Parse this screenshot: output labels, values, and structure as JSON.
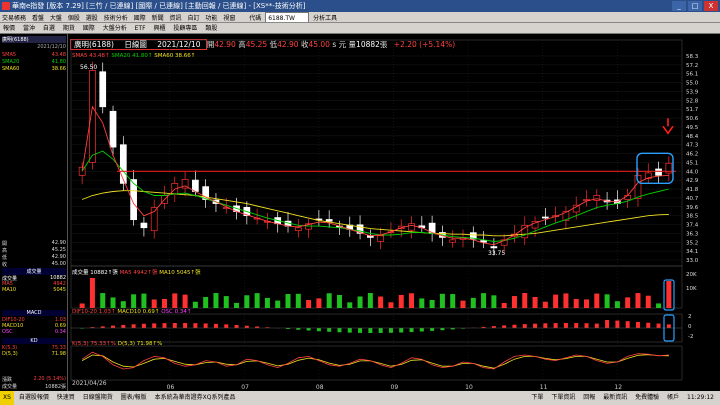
{
  "window": {
    "title": "華南e指發 [版本 7.29] [三竹 / 已連線] [國際 / 已連線] [主動回報 / 已連線] - [XS**-技術分析]",
    "controls": [
      "_",
      "□",
      "X"
    ]
  },
  "menubar": [
    "交易帳務",
    "看盤",
    "大盤",
    "個股",
    "選股",
    "技術分析",
    "國際",
    "新聞",
    "資訊",
    "自訂",
    "功能",
    "視窗"
  ],
  "toolbar": {
    "items": [
      "報價",
      "當沖",
      "自選",
      "期貨",
      "國際",
      "大盤分析",
      "ETF",
      "興櫃",
      "投顧專區",
      "類股"
    ],
    "code_label": "代碼",
    "code_value": "6188.TW",
    "analysis_tool": "分析工具"
  },
  "left_panel": {
    "tab": "廣明(6188)",
    "date_label": "2021/12/10",
    "legend_top": [
      {
        "name": "SMA5",
        "value": "43.48"
      },
      {
        "name": "SMA20",
        "value": "41.80"
      },
      {
        "name": "SMA60",
        "value": "38.66"
      }
    ],
    "quote": [
      {
        "label": "開",
        "value": "42.90"
      },
      {
        "label": "高",
        "value": "45.25"
      },
      {
        "label": "低",
        "value": "42.90"
      },
      {
        "label": "收",
        "value": "45.00"
      }
    ],
    "volume_title": "成交量",
    "volume_rows": [
      {
        "name": "成交量",
        "value": "10882"
      },
      {
        "name": "MA5",
        "value": "4942"
      },
      {
        "name": "MA10",
        "value": "5045"
      }
    ],
    "macd_title": "MACD",
    "macd_rows": [
      {
        "name": "DIF10-20",
        "value": "1.03"
      },
      {
        "name": "MACD10",
        "value": "0.69"
      },
      {
        "name": "OSC",
        "value": "0.34"
      }
    ],
    "kd_title": "KD",
    "kd_rows": [
      {
        "name": "K(5,3)",
        "value": "75.33"
      },
      {
        "name": "D(5,3)",
        "value": "71.98"
      }
    ],
    "footer": [
      {
        "label": "漲跌",
        "value": "2.20 (5.14%)"
      },
      {
        "label": "成交量",
        "value": "10882張"
      }
    ]
  },
  "chart_header": {
    "name": "廣明(6188)",
    "period": "日線圖",
    "date": "2021/12/10",
    "open_label": "開",
    "open": "42.90",
    "high_label": "高",
    "high": "45.25",
    "low_label": "低",
    "low": "42.90",
    "close_label": "收",
    "close": "45.00",
    "unit": "s 元",
    "vol_label": "量",
    "volume": "10882",
    "vol_unit": "張",
    "change": "+2.20 (+5.14%)"
  },
  "indicator_headers": {
    "ma": [
      {
        "text": "SMA5 43.48↑",
        "color": "#ff4040"
      },
      {
        "text": "SMA20 41.80↑",
        "color": "#00d000"
      },
      {
        "text": "SMA60 38.66↑",
        "color": "#f0e020"
      }
    ],
    "volume": [
      {
        "text": "成交量 10882↑張",
        "color": "#ffffff"
      },
      {
        "text": "MA5 4942↑張",
        "color": "#ff4040"
      },
      {
        "text": "MA10 5045↑張",
        "color": "#f0e020"
      }
    ],
    "macd": [
      {
        "text": "DIF10-20 1.03↑",
        "color": "#ff4040"
      },
      {
        "text": "MACD10 0.69↑",
        "color": "#f0e020"
      },
      {
        "text": "OSC 0.34↑",
        "color": "#ff40ff"
      }
    ],
    "kd": [
      {
        "text": "K(5,3) 75.33↑%",
        "color": "#ff4040"
      },
      {
        "text": "D(5,3) 71.98↑%",
        "color": "#f0e020"
      }
    ]
  },
  "chart_data": {
    "type": "candlestick",
    "start_date_label": "2021/04/26",
    "month_ticks": [
      "06",
      "07",
      "08",
      "09",
      "10",
      "11",
      "12"
    ],
    "price_axis": [
      "58.3",
      "57.2",
      "56.1",
      "55.0",
      "53.9",
      "52.8",
      "51.7",
      "50.6",
      "49.5",
      "48.4",
      "47.3",
      "46.2",
      "45.1",
      "44.0",
      "42.9",
      "41.8",
      "40.7",
      "39.6",
      "38.5",
      "37.4",
      "36.3",
      "35.2",
      "34.1",
      "33.0"
    ],
    "ylim": [
      33.0,
      58.3
    ],
    "annotations": {
      "high_label": "56.50",
      "low_label": "33.75",
      "resistance_level": 44.0
    },
    "volume_axis": [
      "20K",
      "10K"
    ],
    "macd_axis": [
      "2",
      "0",
      "-2"
    ],
    "kd_axis": [],
    "close_path": [
      44.5,
      56.5,
      52.0,
      47.0,
      42.5,
      38.0,
      37.0,
      39.5,
      41.0,
      42.5,
      43.0,
      41.5,
      40.5,
      40.0,
      39.5,
      39.0,
      38.5,
      38.2,
      37.8,
      37.5,
      37.2,
      37.0,
      37.5,
      38.0,
      37.8,
      37.2,
      36.8,
      36.3,
      35.8,
      36.0,
      36.5,
      37.2,
      37.5,
      37.0,
      36.3,
      35.8,
      35.5,
      35.8,
      35.6,
      35.2,
      34.5,
      35.5,
      36.2,
      37.3,
      37.8,
      38.2,
      38.5,
      39.0,
      39.8,
      40.5,
      41.0,
      40.2,
      40.0,
      41.0,
      43.5,
      43.8,
      43.5,
      45.0
    ],
    "sma5": [
      44.0,
      52.0,
      50.0,
      46.0,
      43.0,
      40.0,
      38.5,
      39.0,
      40.5,
      41.8,
      42.2,
      41.5,
      40.8,
      40.2,
      39.6,
      39.0,
      38.6,
      38.2,
      37.8,
      37.5,
      37.2,
      37.1,
      37.4,
      37.7,
      37.6,
      37.2,
      36.8,
      36.4,
      36.0,
      36.1,
      36.5,
      37.0,
      37.3,
      37.0,
      36.4,
      36.0,
      35.7,
      35.7,
      35.5,
      35.1,
      34.9,
      35.4,
      36.1,
      37.0,
      37.6,
      38.0,
      38.4,
      38.9,
      39.6,
      40.3,
      40.6,
      40.3,
      40.2,
      41.0,
      42.6,
      43.2,
      43.4,
      43.5
    ],
    "sma20": [
      44.0,
      46.0,
      46.5,
      45.5,
      44.0,
      42.5,
      41.5,
      41.0,
      41.0,
      41.2,
      41.3,
      41.0,
      40.6,
      40.2,
      39.8,
      39.4,
      39.0,
      38.6,
      38.2,
      37.9,
      37.6,
      37.3,
      37.2,
      37.2,
      37.1,
      37.0,
      36.8,
      36.6,
      36.3,
      36.1,
      36.1,
      36.2,
      36.4,
      36.4,
      36.3,
      36.1,
      35.9,
      35.8,
      35.7,
      35.5,
      35.3,
      35.4,
      35.7,
      36.1,
      36.6,
      37.1,
      37.6,
      38.0,
      38.5,
      39.0,
      39.5,
      39.8,
      40.0,
      40.3,
      40.8,
      41.2,
      41.5,
      41.8
    ],
    "sma60": [
      40.5,
      41.0,
      41.3,
      41.5,
      41.6,
      41.6,
      41.5,
      41.4,
      41.3,
      41.2,
      41.1,
      41.0,
      40.8,
      40.6,
      40.4,
      40.2,
      40.0,
      39.7,
      39.4,
      39.1,
      38.8,
      38.5,
      38.2,
      37.9,
      37.7,
      37.5,
      37.3,
      37.1,
      36.9,
      36.8,
      36.7,
      36.6,
      36.5,
      36.4,
      36.3,
      36.3,
      36.2,
      36.2,
      36.1,
      36.1,
      36.0,
      36.0,
      36.1,
      36.2,
      36.3,
      36.5,
      36.7,
      36.9,
      37.1,
      37.3,
      37.5,
      37.7,
      37.9,
      38.1,
      38.3,
      38.5,
      38.6,
      38.66
    ],
    "kd_k": [
      60,
      85,
      70,
      40,
      25,
      30,
      55,
      70,
      65,
      45,
      35,
      40,
      55,
      50,
      35,
      40,
      60,
      55,
      40,
      30,
      45,
      65,
      70,
      55,
      40,
      35,
      45,
      60,
      55,
      40,
      30,
      45,
      65,
      60,
      40,
      30,
      35,
      50,
      45,
      30,
      25,
      50,
      70,
      75,
      70,
      60,
      55,
      65,
      75,
      70,
      55,
      45,
      50,
      70,
      80,
      78,
      72,
      75
    ],
    "kd_d": [
      55,
      75,
      72,
      50,
      35,
      32,
      45,
      60,
      63,
      52,
      42,
      40,
      48,
      50,
      42,
      40,
      52,
      54,
      46,
      36,
      42,
      56,
      64,
      58,
      46,
      38,
      42,
      54,
      54,
      45,
      35,
      41,
      56,
      58,
      46,
      35,
      35,
      45,
      45,
      35,
      28,
      42,
      60,
      70,
      70,
      63,
      58,
      62,
      70,
      70,
      60,
      50,
      50,
      63,
      74,
      76,
      73,
      72
    ]
  },
  "statusbar": {
    "items": [
      "XS",
      "自選股報價",
      "快速買",
      "日線盤期貨",
      "圖表/報版"
    ],
    "message": "本系統為華南證券XQ系列產品",
    "right_items": [
      "下單",
      "下單資訊",
      "回報",
      "最新資訊",
      "免費體驗",
      "帳戶",
      "11:29:12"
    ]
  }
}
